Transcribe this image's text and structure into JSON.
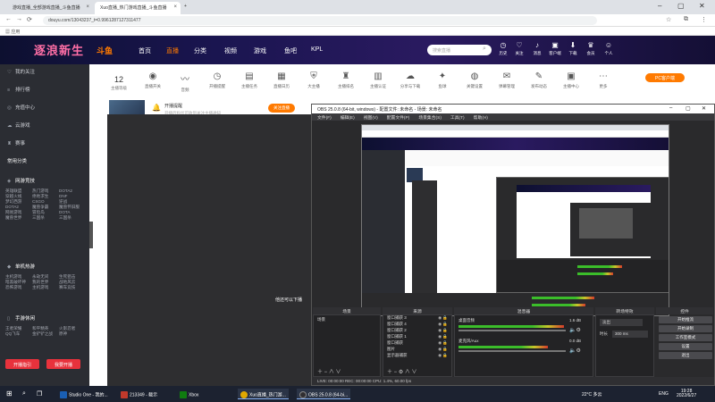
{
  "browser": {
    "tabs": [
      {
        "label": "游戏直播_全部游戏直播_斗鱼直播"
      },
      {
        "label": "Xuo直播_热门游戏直播_斗鱼直播"
      }
    ],
    "address": "douyu.com/13043237_t=0.9961287127311477",
    "bookmark": "应用"
  },
  "douyu": {
    "logo": "斗鱼",
    "banner_text": "逐浪新生",
    "nav": [
      "首页",
      "直播",
      "分类",
      "视频",
      "游戏",
      "鱼吧",
      "KPL"
    ],
    "search_placeholder": "搜索直播",
    "header_icons": [
      {
        "icon": "bell-icon",
        "label": "历史"
      },
      {
        "icon": "heart-icon",
        "label": "关注"
      },
      {
        "icon": "bell2-icon",
        "label": "消息"
      },
      {
        "icon": "box-icon",
        "label": "客户端"
      },
      {
        "icon": "gift-icon",
        "label": "下载"
      },
      {
        "icon": "crown-icon",
        "label": "会员"
      },
      {
        "icon": "user-icon",
        "label": "个人"
      }
    ]
  },
  "sidebar": {
    "items": [
      "我的关注",
      "排行榜",
      "充值中心",
      "云游戏",
      "赛事"
    ],
    "section_common": "常用分类",
    "section_net": "网游竞技",
    "net_games": [
      "英雄联盟",
      "热门游戏",
      "DOTA2",
      "穿越火线",
      "绝地求生",
      "DNF",
      "梦幻西游",
      "CSGO",
      "逆战",
      "DOTA2",
      "魔兽争霸",
      "魔兽怀旧服",
      "网易游戏",
      "冒险岛",
      "DOTA",
      "魔兽世界",
      "三国杀",
      "三国杀"
    ],
    "section_mobile": "单机热游",
    "mobile_games": [
      "主机游戏",
      "永劫无间",
      "生死狙击",
      "暗黑破坏神",
      "我的世界",
      "战地风云",
      "恐怖游戏",
      "主机游戏",
      "赛车竞技"
    ],
    "section_hand": "手游休闲",
    "hand_games": [
      "王者荣耀",
      "和平精英",
      "火影忍者",
      "QQ飞车",
      "金铲铲之战",
      "原神",
      "英雄联盟手游",
      "第五人格"
    ],
    "btn_live": "开播指引",
    "btn_open": "我要开播"
  },
  "main": {
    "level_count": "12",
    "level_label": "主播等级",
    "tools": [
      {
        "icon": "fire-icon",
        "label": "直播开关"
      },
      {
        "icon": "wave-icon",
        "label": "音频"
      },
      {
        "icon": "clock-icon",
        "label": "开播提醒"
      },
      {
        "icon": "note-icon",
        "label": "主播任务"
      },
      {
        "icon": "calendar-icon",
        "label": "直播日历"
      },
      {
        "icon": "shield-icon",
        "label": "大主播"
      },
      {
        "icon": "trophy-icon",
        "label": "主播排名"
      },
      {
        "icon": "doc-icon",
        "label": "主播认证"
      },
      {
        "icon": "cloud-icon",
        "label": "分享与下载"
      },
      {
        "icon": "star-icon",
        "label": "鱼球"
      },
      {
        "icon": "eye-icon",
        "label": "关键设置"
      },
      {
        "icon": "chat-icon",
        "label": "弹幕管理"
      },
      {
        "icon": "edit-icon",
        "label": "发布动态"
      },
      {
        "icon": "cam-icon",
        "label": "主播中心"
      },
      {
        "icon": "more-icon",
        "label": "更多"
      }
    ],
    "pc_button": "PC客户端",
    "profile": {
      "name": "逆神",
      "status_text": "开播提醒",
      "sub_text": "开播后粉丝可收到关注主播通知",
      "tag": "1周榜",
      "btn_follow": "关注直播",
      "pill_a": "房间管理员",
      "pill_b": "直播间任务"
    },
    "overlay_text": "他还可以下播"
  },
  "obs": {
    "title": "OBS 25.0.8 (64-bit, windows) - 配置文件: 未命名 - 场景: 未命名",
    "menu": [
      "文件(F)",
      "编辑(E)",
      "视图(V)",
      "配置文件(P)",
      "场景集合(S)",
      "工具(T)",
      "帮助(H)"
    ],
    "panels": {
      "scenes": "场景",
      "sources": "来源",
      "mixer": "混音器",
      "transitions": "转场特效",
      "controls": "控件"
    },
    "scene_item": "场景",
    "sources": [
      "窗口捕获 3",
      "窗口捕获 4",
      "窗口捕获 2",
      "窗口捕获 1",
      "窗口捕获",
      "图片",
      "显示器捕获"
    ],
    "mixer_rows": [
      {
        "name": "桌面音频",
        "db": "1.6 dB"
      },
      {
        "name": "麦克风/Aux",
        "db": "0.0 dB"
      }
    ],
    "transition": "淡出",
    "duration_label": "时长",
    "duration": "300 ms",
    "controls": [
      "开始推流",
      "开始录制",
      "工作室模式",
      "设置",
      "退出"
    ],
    "status": "LIVE: 00:00:00   REC: 00:00:00   CPU: 1.4%, 60.00 fps"
  },
  "taskbar": {
    "apps": [
      {
        "label": "Studio One - 我的..."
      },
      {
        "label": "213349 - 截示"
      },
      {
        "label": "Xbox"
      },
      {
        "label": "Xuo直播_热门游..."
      },
      {
        "label": "OBS 25.0.8 (64-bi..."
      }
    ],
    "weather": "22°C 多云",
    "lang": "ENG",
    "time": "19:28",
    "date": "2022/6/27"
  },
  "colors": {
    "accent": "#ff7a00",
    "live_red": "#e8323c",
    "obs_bg": "#2a2a2c"
  }
}
